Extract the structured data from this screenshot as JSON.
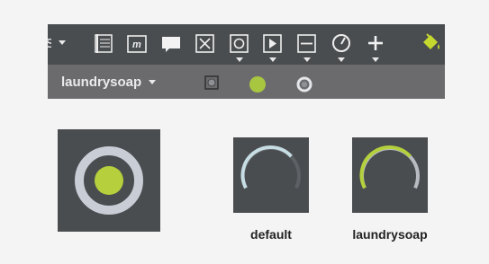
{
  "toolbar": {
    "tools": [
      {
        "icon": "first-partial-icon",
        "has_caret": true
      },
      {
        "icon": "page-lines-icon",
        "has_caret": false
      },
      {
        "icon": "italic-m-box-icon",
        "has_caret": false
      },
      {
        "icon": "speech-bubble-icon",
        "has_caret": false
      },
      {
        "icon": "close-box-icon",
        "has_caret": false
      },
      {
        "icon": "radio-button-icon",
        "has_caret": true
      },
      {
        "icon": "play-box-icon",
        "has_caret": true
      },
      {
        "icon": "minus-box-icon",
        "has_caret": true
      },
      {
        "icon": "gauge-icon",
        "has_caret": true
      },
      {
        "icon": "plus-icon",
        "has_caret": true
      },
      {
        "icon": "paint-bucket-icon",
        "has_caret": false
      }
    ],
    "accent_color": "#c4d82e"
  },
  "subbar": {
    "theme_name": "laundrysoap",
    "variants": [
      {
        "icon": "square-radio-icon"
      },
      {
        "icon": "filled-dot-icon",
        "color": "#a8c640"
      },
      {
        "icon": "ring-radio-icon"
      }
    ]
  },
  "previews": [
    {
      "name": "radio-preview",
      "caption": ""
    },
    {
      "name": "gauge-default-preview",
      "caption": "default",
      "arc_color": "#c6dde3",
      "track_color": "#5d6064"
    },
    {
      "name": "gauge-laundrysoap-preview",
      "caption": "laundrysoap",
      "arc_color": "#b5d03c",
      "track_color": "#b8bcc2"
    }
  ],
  "colors": {
    "panel_bg": "#4a4d50",
    "ring": "#c9cdd6",
    "dot": "#b5d03c"
  }
}
